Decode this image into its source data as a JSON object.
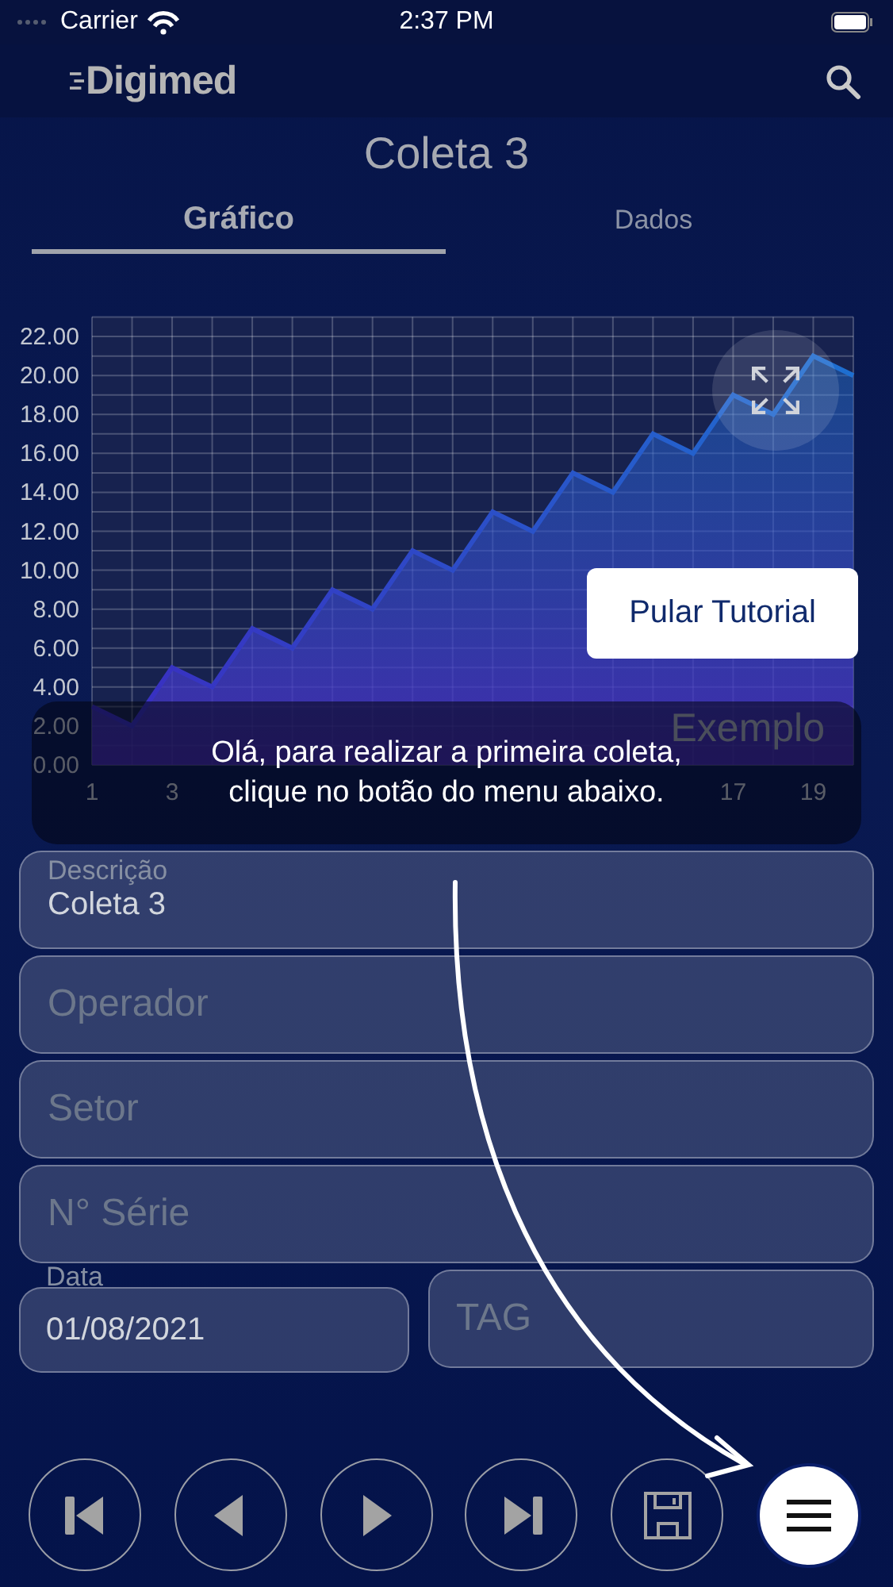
{
  "status_bar": {
    "carrier": "Carrier",
    "time": "2:37 PM"
  },
  "header": {
    "logo": "Digimed"
  },
  "title": "Coleta 3",
  "tabs": [
    {
      "label": "Gráfico",
      "selected": true
    },
    {
      "label": "Dados",
      "selected": false
    }
  ],
  "chart": {
    "watermark": "Exemplo",
    "chart_data": {
      "type": "area",
      "x": [
        1,
        2,
        3,
        4,
        5,
        6,
        7,
        8,
        9,
        10,
        11,
        12,
        13,
        14,
        15,
        16,
        17,
        18,
        19,
        20
      ],
      "series": [
        {
          "color": "#1e6fd0",
          "values": [
            3,
            2,
            5,
            4,
            7,
            6,
            9,
            8,
            11,
            10,
            13,
            12,
            15,
            14,
            17,
            16,
            19,
            18,
            21,
            20
          ]
        }
      ],
      "ylim": [
        0,
        23
      ],
      "xlim": [
        1,
        20
      ],
      "yticks": [
        {
          "value": 0,
          "label": "0.00"
        },
        {
          "value": 2,
          "label": "2.00"
        },
        {
          "value": 4,
          "label": "4.00"
        },
        {
          "value": 6,
          "label": "6.00"
        },
        {
          "value": 8,
          "label": "8.00"
        },
        {
          "value": 10,
          "label": "10.00"
        },
        {
          "value": 12,
          "label": "12.00"
        },
        {
          "value": 14,
          "label": "14.00"
        },
        {
          "value": 16,
          "label": "16.00"
        },
        {
          "value": 18,
          "label": "18.00"
        },
        {
          "value": 20,
          "label": "20.00"
        },
        {
          "value": 22,
          "label": "22.00"
        }
      ],
      "xticks": [
        1,
        3,
        17,
        19
      ],
      "grid": true
    }
  },
  "tutorial": {
    "message": "Olá, para realizar a primeira coleta,\nclique no botão do menu abaixo.",
    "skip_button": "Pular Tutorial"
  },
  "form": {
    "rows": [
      [
        {
          "kind": "inset",
          "label": "Descrição",
          "value": "Coleta 3"
        }
      ],
      [
        {
          "kind": "plain",
          "placeholder": "Operador"
        }
      ],
      [
        {
          "kind": "plain",
          "placeholder": "Setor"
        }
      ],
      [
        {
          "kind": "plain",
          "placeholder": "N° Série"
        }
      ],
      [
        {
          "kind": "outset",
          "label": "Data",
          "value": "01/08/2021"
        },
        {
          "kind": "plain",
          "placeholder": "TAG"
        }
      ]
    ]
  },
  "toolbar": [
    {
      "kind": "first"
    },
    {
      "kind": "previous"
    },
    {
      "kind": "next"
    },
    {
      "kind": "last"
    },
    {
      "kind": "save"
    },
    {
      "kind": "menu"
    }
  ]
}
